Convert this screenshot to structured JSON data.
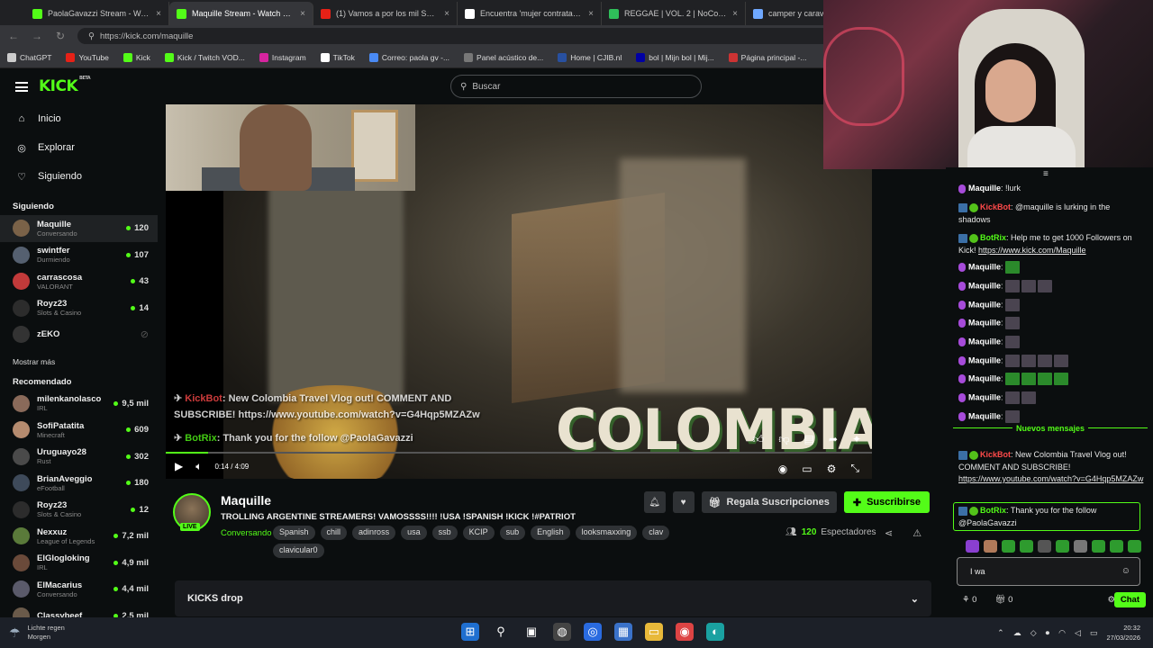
{
  "browser": {
    "tabs": [
      {
        "title": "PaolaGavazzi Stream - Watch Live",
        "color": "#53fc18"
      },
      {
        "title": "Maquille Stream - Watch Live",
        "color": "#53fc18",
        "active": true
      },
      {
        "title": "(1) Vamos a por los mil SEGUIDOR",
        "color": "#e62117"
      },
      {
        "title": "Encuentra 'mujer contrata latinos",
        "color": "#ffffff"
      },
      {
        "title": "REGGAE | VOL. 2 | NoCopyrightVa",
        "color": "#2fbf5a"
      },
      {
        "title": "camper y caravana -",
        "color": "#6fa8ff"
      }
    ],
    "url": "https://kick.com/maquille",
    "bookmarks": [
      {
        "label": "ChatGPT",
        "color": "#cccccc"
      },
      {
        "label": "YouTube",
        "color": "#e62117"
      },
      {
        "label": "Kick",
        "color": "#53fc18"
      },
      {
        "label": "Kick / Twitch VOD...",
        "color": "#53fc18"
      },
      {
        "label": "Instagram",
        "color": "#d6249f"
      },
      {
        "label": "TikTok",
        "color": "#ffffff"
      },
      {
        "label": "Correo: paola gv -...",
        "color": "#4a8af4"
      },
      {
        "label": "Panel acústico de...",
        "color": "#777777"
      },
      {
        "label": "Home | CJIB.nl",
        "color": "#2850a0"
      },
      {
        "label": "bol | Mijn bol | Mij...",
        "color": "#0000a4"
      },
      {
        "label": "Página principal -...",
        "color": "#cc3333"
      }
    ]
  },
  "header": {
    "logo": "KICK",
    "logo_badge": "BETA",
    "search_placeholder": "Buscar"
  },
  "sidebar": {
    "nav": [
      {
        "label": "Inicio",
        "icon": "home-icon"
      },
      {
        "label": "Explorar",
        "icon": "compass-icon"
      },
      {
        "label": "Siguiendo",
        "icon": "heart-icon"
      }
    ],
    "following_title": "Siguiendo",
    "following": [
      {
        "name": "Maquille",
        "game": "Conversando",
        "viewers": "120",
        "color": "#7a6248"
      },
      {
        "name": "swintfer",
        "game": "Durmiendo",
        "viewers": "107",
        "color": "#556070"
      },
      {
        "name": "carrascosa",
        "game": "VALORANT",
        "viewers": "43",
        "color": "#c23a3a"
      },
      {
        "name": "Royz23",
        "game": "Slots & Casino",
        "viewers": "14",
        "color": "#2c2c2c"
      },
      {
        "name": "zEKO",
        "game": "",
        "viewers": "",
        "color": "#333333"
      }
    ],
    "show_more": "Mostrar más",
    "recommended_title": "Recomendado",
    "recommended": [
      {
        "name": "milenkanolasco",
        "game": "IRL",
        "viewers": "9,5 mil",
        "color": "#8a6a5a"
      },
      {
        "name": "SofiPatatita",
        "game": "Minecraft",
        "viewers": "609",
        "color": "#b58b6f"
      },
      {
        "name": "Uruguayo28",
        "game": "Rust",
        "viewers": "302",
        "color": "#4a4a4a"
      },
      {
        "name": "BrianAveggio",
        "game": "eFootball",
        "viewers": "180",
        "color": "#3e4a5a"
      },
      {
        "name": "Royz23",
        "game": "Slots & Casino",
        "viewers": "12",
        "color": "#2c2c2c"
      },
      {
        "name": "Nexxuz",
        "game": "League of Legends",
        "viewers": "7,2 mil",
        "color": "#5a7a3a"
      },
      {
        "name": "ElGlogloking",
        "game": "IRL",
        "viewers": "4,9 mil",
        "color": "#6a4a3a"
      },
      {
        "name": "ElMacarius",
        "game": "Conversando",
        "viewers": "4,4 mil",
        "color": "#5a5a6a"
      },
      {
        "name": "Classybeef",
        "game": "",
        "viewers": "2,5 mil",
        "color": "#6a5a4a"
      }
    ]
  },
  "video": {
    "overlay_text": "COLOMBIA",
    "overlay_line1_user": "KickBot",
    "overlay_line1_text": ": New Colombia Travel Vlog out! COMMENT AND",
    "overlay_line2_text": "SUBSCRIBE! https://www.youtube.com/watch?v=G4Hqp5MZAZw",
    "overlay_line3_user": "BotRix",
    "overlay_line3_text": ": Thank you for the follow @PaolaGavazzi",
    "time": "0:14 / 4:09",
    "progress": 0.06
  },
  "stream": {
    "channel": "Maquille",
    "live_badge": "LIVE",
    "title": "TROLLING ARGENTINE STREAMERS! VAMOSSSS!!!! !USA !SPANISH !KICK !#PATRIOT",
    "category": "Conversando",
    "tags": [
      "Spanish",
      "chill",
      "adinross",
      "usa",
      "ssb",
      "KCIP",
      "sub",
      "English",
      "looksmaxxing",
      "clav",
      "clavicular0"
    ],
    "gift_label": "Regala Suscripciones",
    "subscribe_label": "Suscribirse",
    "viewers": "120",
    "viewers_label": "Espectadores",
    "kicks_drop": "KICKS drop"
  },
  "chat": {
    "messages": [
      {
        "user": "Maquille",
        "text": ": !lurk",
        "color": "#ffffff"
      },
      {
        "user": "KickBot",
        "text": ": @maquille is lurking in the shadows",
        "color": "#ff4a4a"
      },
      {
        "user": "BotRix",
        "text": ": Help me to get 1000 Followers on Kick! ",
        "link": "https://www.kick.com/Maquille",
        "color": "#53fc18"
      },
      {
        "user": "Maquille",
        "text": ":",
        "color": "#ffffff"
      },
      {
        "user": "Maquille",
        "text": ":",
        "color": "#ffffff"
      },
      {
        "user": "Maquille",
        "text": ":",
        "color": "#ffffff"
      },
      {
        "user": "Maquille",
        "text": ":",
        "color": "#ffffff"
      },
      {
        "user": "Maquille",
        "text": ":",
        "color": "#ffffff"
      },
      {
        "user": "Maquille",
        "text": ":",
        "color": "#ffffff"
      },
      {
        "user": "Maquille",
        "text": ":",
        "color": "#ffffff"
      },
      {
        "user": "Maquille",
        "text": ":",
        "color": "#ffffff"
      },
      {
        "user": "Maquille",
        "text": ":",
        "color": "#ffffff"
      }
    ],
    "new_messages": "Nuevos mensajes",
    "kickbot_user": "KickBot",
    "kickbot_text": ": New Colombia Travel Vlog out! COMMENT AND SUBSCRIBE! ",
    "kickbot_link": "https://www.youtube.com/watch?v=G4Hqp5MZAZw",
    "botrix_user": "BotRix",
    "botrix_text": ": Thank you for the follow @PaolaGavazzi",
    "input_value": "I wa",
    "footer_left": "0",
    "footer_mid": "0",
    "send_label": "Chat"
  },
  "taskbar": {
    "weather_line1": "Lichte regen",
    "weather_line2": "Morgen",
    "time": "20:32",
    "date": "27/03/2026"
  }
}
